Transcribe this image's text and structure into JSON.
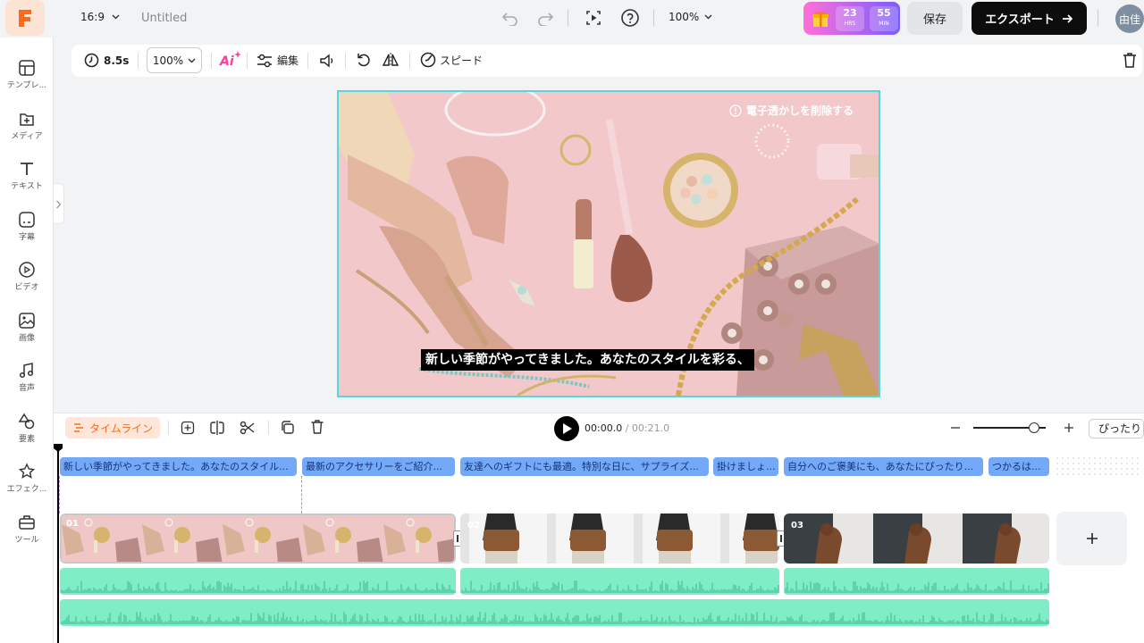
{
  "topbar": {
    "aspect_ratio": "16:9",
    "project_name": "Untitled",
    "zoom": "100%",
    "promo": {
      "hours": "23",
      "hours_unit": "HRS",
      "minutes": "55",
      "minutes_unit": "MIN"
    },
    "save_label": "保存",
    "export_label": "エクスポート",
    "avatar_text": "由佳"
  },
  "sidebar": {
    "items": [
      {
        "label": "テンプレ...",
        "icon": "template-icon"
      },
      {
        "label": "メディア",
        "icon": "media-icon"
      },
      {
        "label": "テキスト",
        "icon": "text-icon"
      },
      {
        "label": "字幕",
        "icon": "subtitle-icon"
      },
      {
        "label": "ビデオ",
        "icon": "video-icon"
      },
      {
        "label": "画像",
        "icon": "image-icon"
      },
      {
        "label": "音声",
        "icon": "audio-icon"
      },
      {
        "label": "要素",
        "icon": "elements-icon"
      },
      {
        "label": "エフェク...",
        "icon": "effects-icon"
      },
      {
        "label": "ツール",
        "icon": "tools-icon"
      }
    ]
  },
  "toolbar": {
    "duration": "8.5s",
    "scale": "100%",
    "ai_label": "Ai",
    "edit_label": "編集",
    "speed_label": "スピード"
  },
  "canvas": {
    "watermark_label": "電子透かしを削除する",
    "subtitle": "新しい季節がやってきました。あなたのスタイルを彩る、"
  },
  "timeline": {
    "timeline_label": "タイムライン",
    "current_time": "00:00.0",
    "separator": " / ",
    "total_time": "00:21.0",
    "fit_label": "ぴったり",
    "zoom_slider_value": 0.9,
    "captions": [
      "新しい季節がやってきました。あなたのスタイル...",
      "最新のアクセサリーをご紹介...",
      "友達へのギフトにも最適。特別な日に、サプライズ...",
      "掛けましょ...",
      "自分へのご褒美にも、あなたにぴったり...",
      "つかるは..."
    ],
    "clips": [
      {
        "index": "01"
      },
      {
        "index": "02"
      },
      {
        "index": "03"
      }
    ]
  },
  "colors": {
    "accent": "#ff6a1a",
    "canvas_border": "#58d6dc",
    "caption_bg": "#74a9f7",
    "audio_wave": "#7fedc6",
    "export_bg": "#0d0d0d",
    "promo_gradient_start": "#ff6fd8",
    "promo_gradient_end": "#7b5cff"
  }
}
